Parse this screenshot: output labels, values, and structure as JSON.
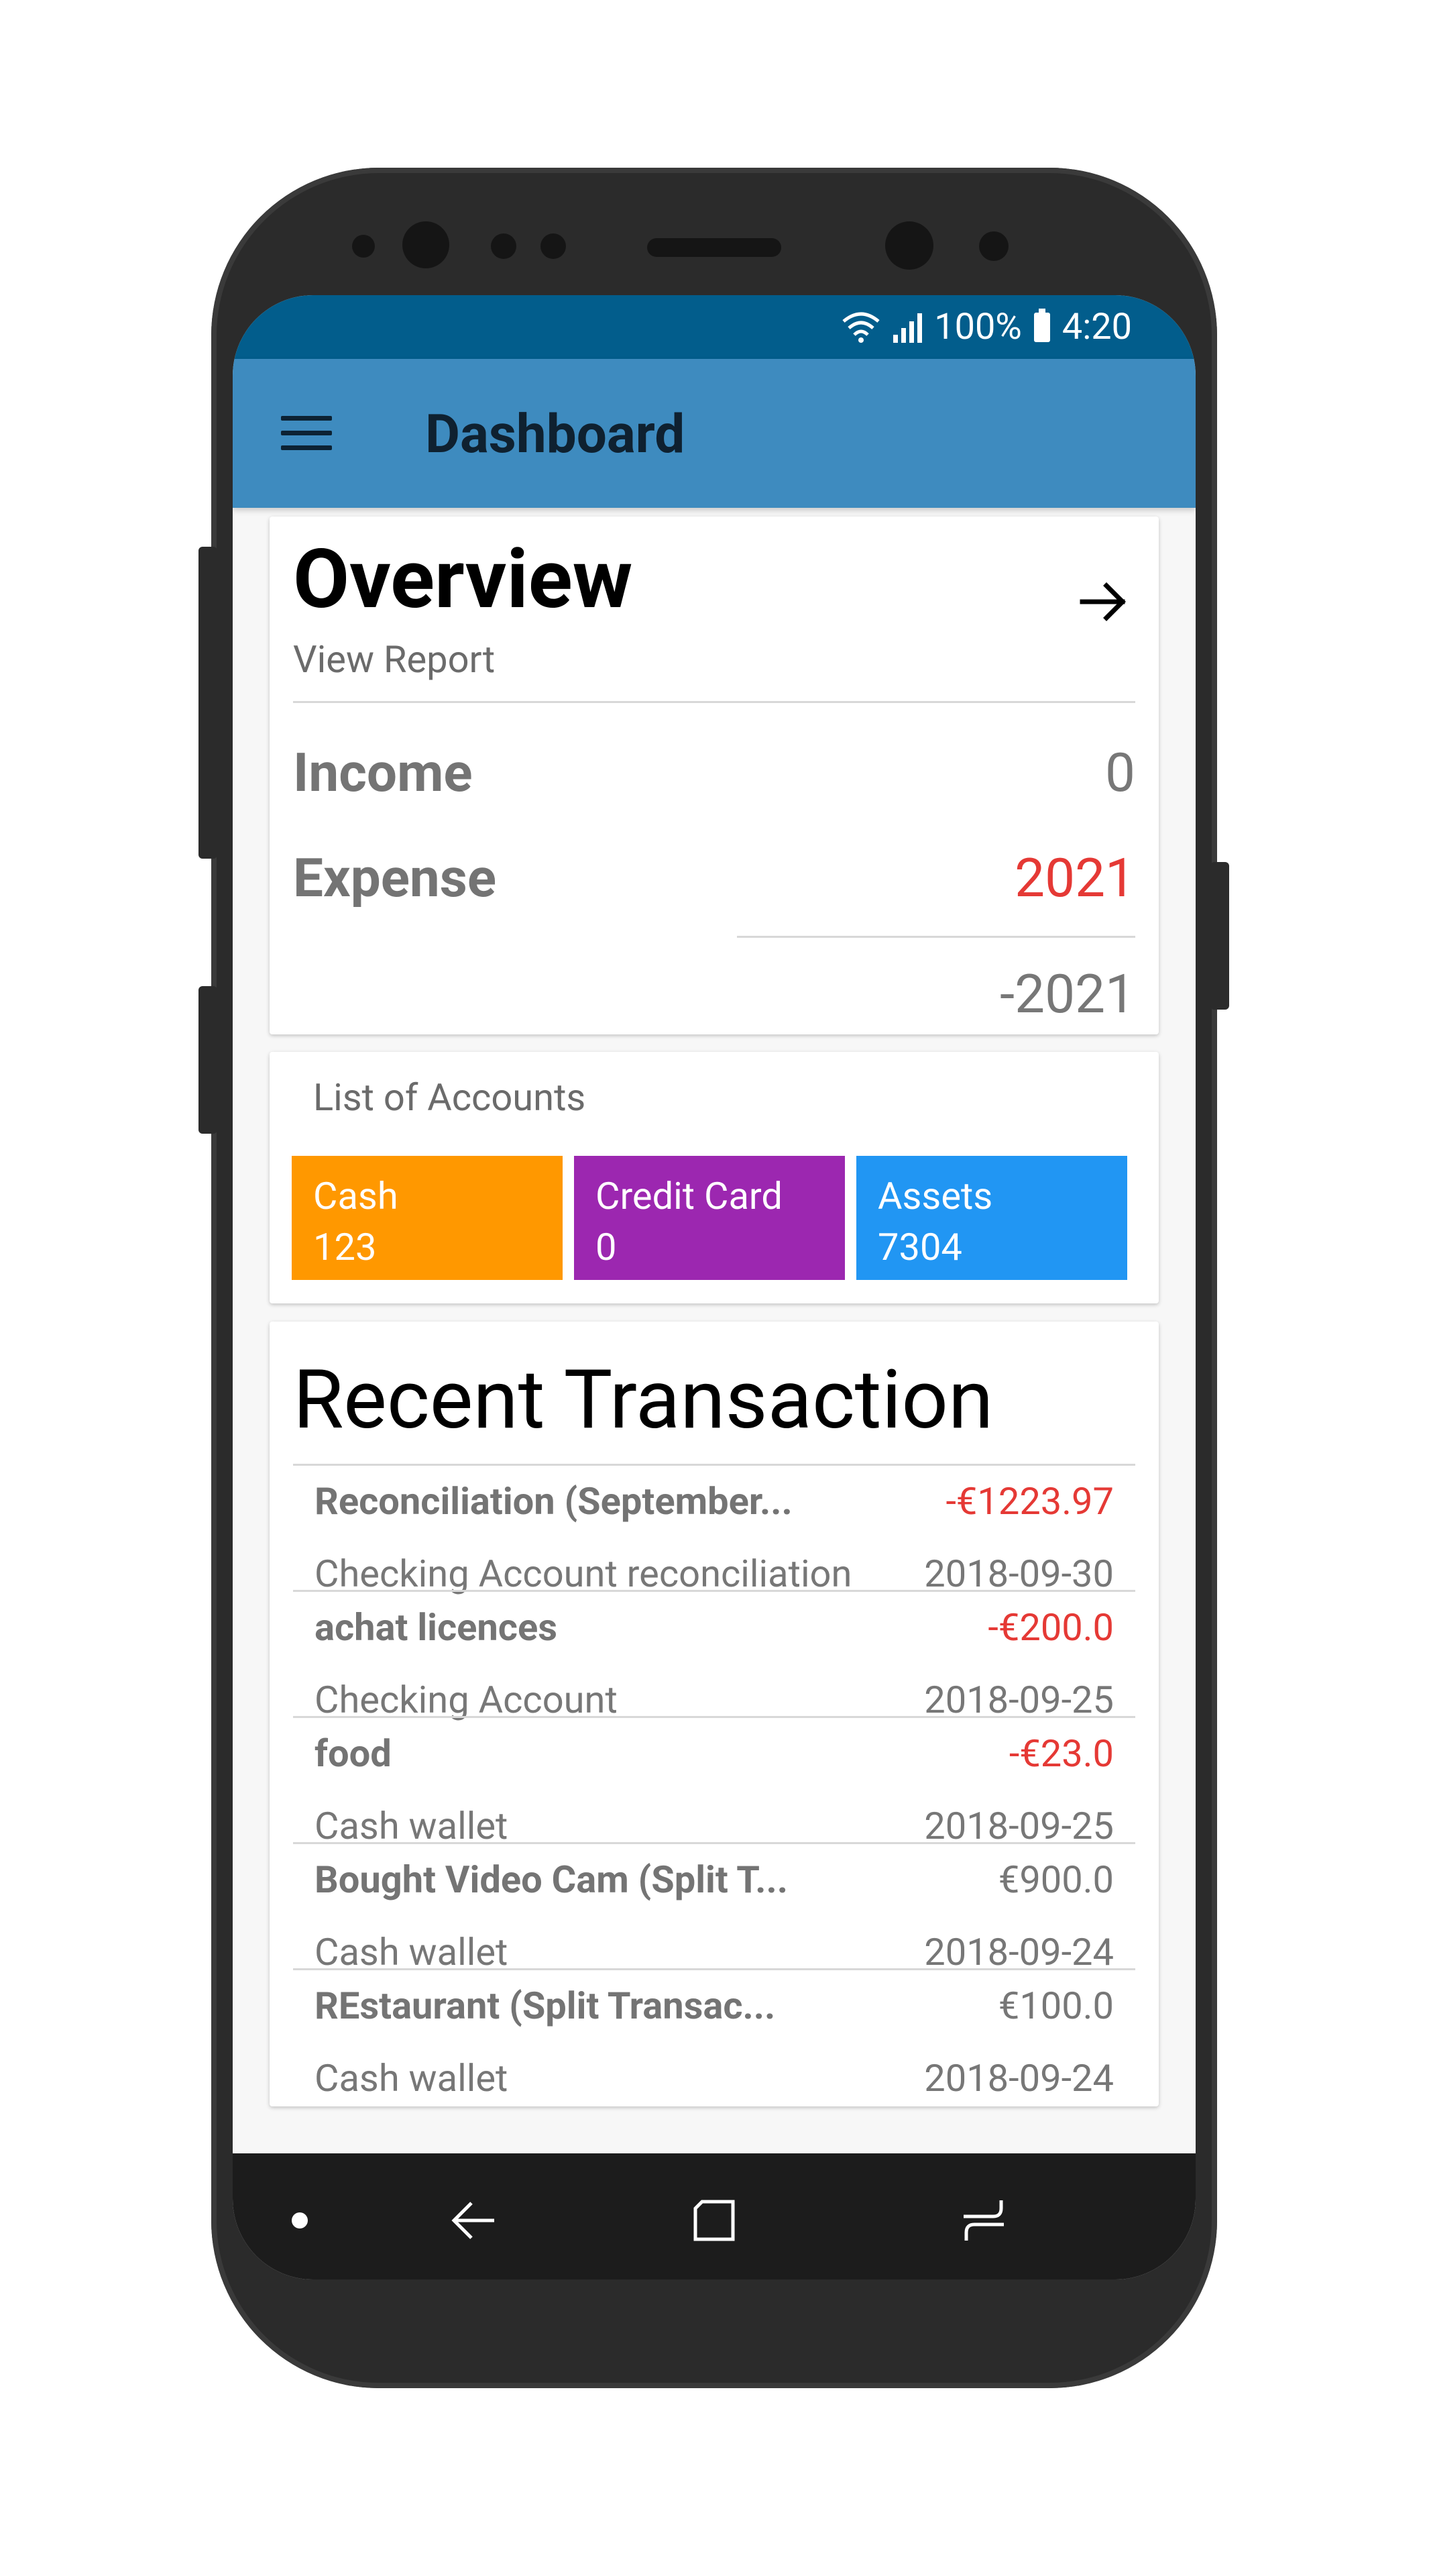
{
  "status_bar": {
    "battery": "100%",
    "time": "4:20"
  },
  "app_bar": {
    "title": "Dashboard",
    "menu_icon": "hamburger-menu-icon"
  },
  "overview": {
    "title": "Overview",
    "link": "View Report",
    "arrow_icon": "arrow-right-icon",
    "income_label": "Income",
    "income_value": "0",
    "expense_label": "Expense",
    "expense_value": "2021",
    "total_value": "-2021"
  },
  "accounts": {
    "heading": "List of Accounts",
    "items": [
      {
        "name": "Cash",
        "value": "123",
        "color": "#ff9800"
      },
      {
        "name": "Credit Card",
        "value": "0",
        "color": "#9c27b0"
      },
      {
        "name": "Assets",
        "value": "7304",
        "color": "#2196f3"
      }
    ]
  },
  "recent": {
    "title": "Recent Transaction",
    "transactions": [
      {
        "name": "Reconciliation (September...",
        "amount": "-€1223.97",
        "negative": true,
        "account": "Checking Account reconciliation",
        "date": "2018-09-30"
      },
      {
        "name": "achat licences",
        "amount": "-€200.0",
        "negative": true,
        "account": "Checking Account",
        "date": "2018-09-25"
      },
      {
        "name": "food",
        "amount": "-€23.0",
        "negative": true,
        "account": "Cash wallet",
        "date": "2018-09-25"
      },
      {
        "name": "Bought Video Cam (Split T...",
        "amount": "€900.0",
        "negative": false,
        "account": "Cash wallet",
        "date": "2018-09-24"
      },
      {
        "name": "REstaurant (Split Transac...",
        "amount": "€100.0",
        "negative": false,
        "account": "Cash wallet",
        "date": "2018-09-24"
      }
    ]
  },
  "nav_bar": {
    "icons": [
      "nav-dot-icon",
      "back-icon",
      "home-square-icon",
      "recent-apps-icon"
    ]
  },
  "colors": {
    "status_bar": "#025d8c",
    "app_bar": "#3e8bbf",
    "negative": "#e53935"
  }
}
